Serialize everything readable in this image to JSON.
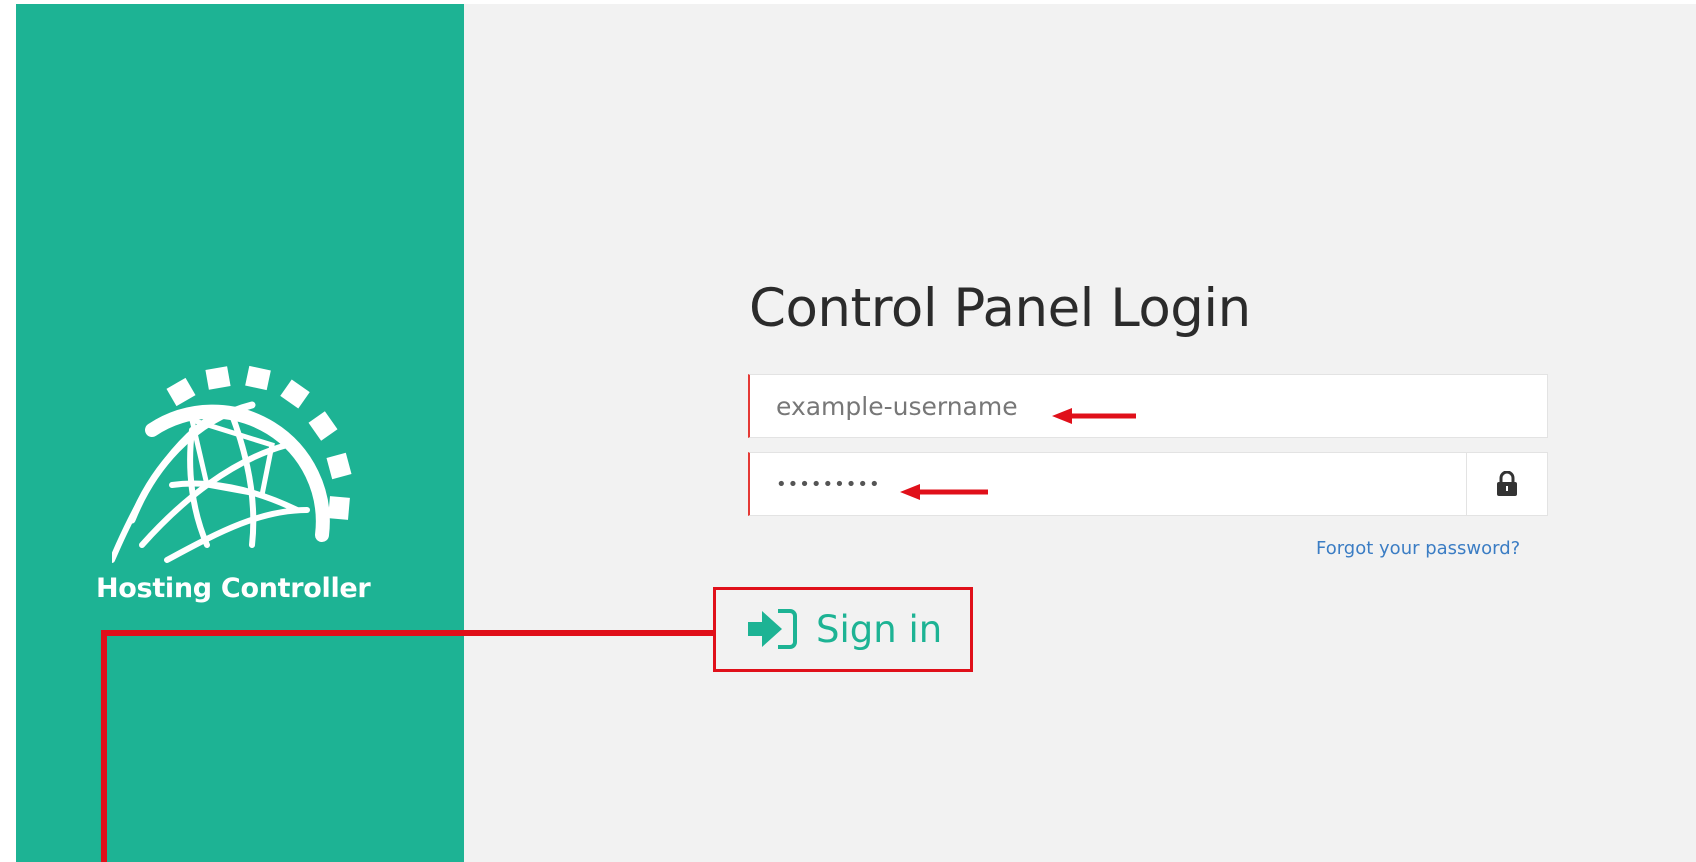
{
  "brand": {
    "name": "Hosting Controller"
  },
  "login": {
    "title": "Control Panel Login",
    "username": {
      "value": "example-username",
      "placeholder": ""
    },
    "password": {
      "value": "•••••••••"
    },
    "forgot_link": "Forgot your password?",
    "signin_label": "Sign in"
  },
  "colors": {
    "accent": "#1db394",
    "annotation": "#e0101a",
    "link": "#3b7dc4",
    "background": "#f2f2f2"
  },
  "icons": {
    "logo": "globe-gear-icon",
    "lock": "lock-icon",
    "signin": "sign-in-icon",
    "annotation_arrow": "red-arrow-icon"
  }
}
